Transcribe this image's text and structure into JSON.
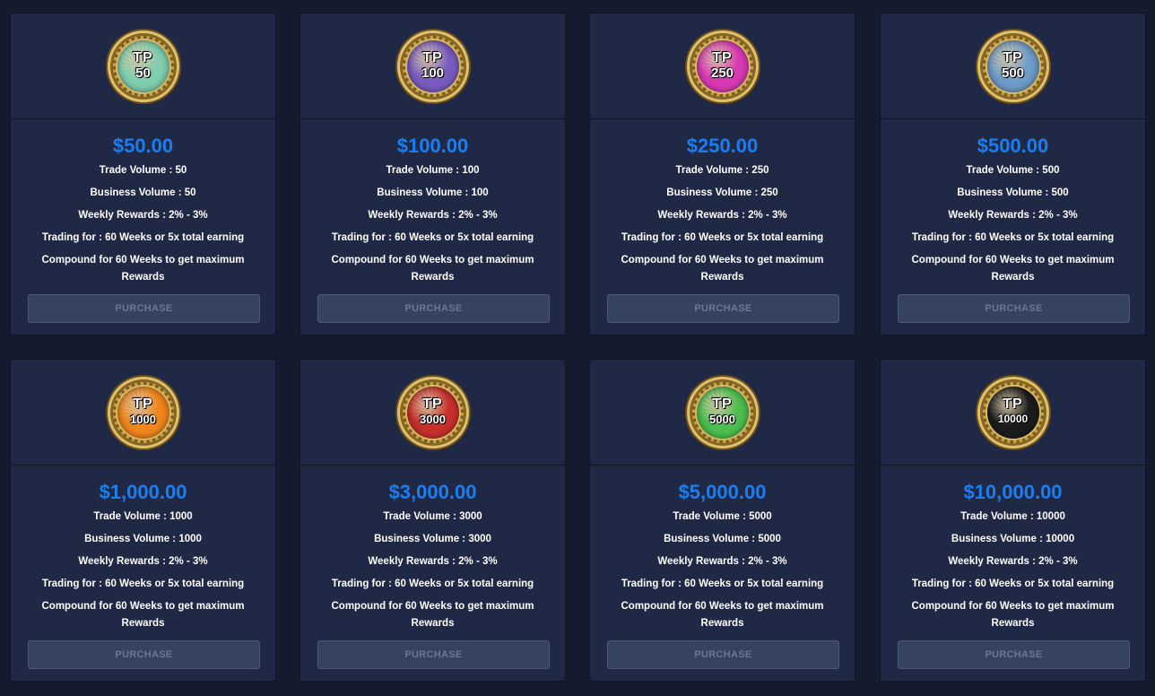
{
  "packages": [
    {
      "tp": "TP",
      "badge_number": "50",
      "badge_color": "#7fcfb0",
      "price": "$50.00",
      "trade_volume": "Trade Volume : 50",
      "business_volume": "Business Volume : 50",
      "weekly_rewards": "Weekly Rewards : 2% - 3%",
      "trading_for": "Trading for : 60 Weeks or 5x total earning",
      "compound": "Compound for 60 Weeks to get maximum Rewards",
      "button": "PURCHASE"
    },
    {
      "tp": "TP",
      "badge_number": "100",
      "badge_color": "#7a5cc0",
      "price": "$100.00",
      "trade_volume": "Trade Volume : 100",
      "business_volume": "Business Volume : 100",
      "weekly_rewards": "Weekly Rewards : 2% - 3%",
      "trading_for": "Trading for : 60 Weeks or 5x total earning",
      "compound": "Compound for 60 Weeks to get maximum Rewards",
      "button": "PURCHASE"
    },
    {
      "tp": "TP",
      "badge_number": "250",
      "badge_color": "#d83ab4",
      "price": "$250.00",
      "trade_volume": "Trade Volume : 250",
      "business_volume": "Business Volume : 250",
      "weekly_rewards": "Weekly Rewards : 2% - 3%",
      "trading_for": "Trading for : 60 Weeks or 5x total earning",
      "compound": "Compound for 60 Weeks to get maximum Rewards",
      "button": "PURCHASE"
    },
    {
      "tp": "TP",
      "badge_number": "500",
      "badge_color": "#6f9cc8",
      "price": "$500.00",
      "trade_volume": "Trade Volume : 500",
      "business_volume": "Business Volume : 500",
      "weekly_rewards": "Weekly Rewards : 2% - 3%",
      "trading_for": "Trading for : 60 Weeks or 5x total earning",
      "compound": "Compound for 60 Weeks to get maximum Rewards",
      "button": "PURCHASE"
    },
    {
      "tp": "TP",
      "badge_number": "1000",
      "badge_color": "#f0861c",
      "price": "$1,000.00",
      "trade_volume": "Trade Volume : 1000",
      "business_volume": "Business Volume : 1000",
      "weekly_rewards": "Weekly Rewards : 2% - 3%",
      "trading_for": "Trading for : 60 Weeks or 5x total earning",
      "compound": "Compound for 60 Weeks to get maximum Rewards",
      "button": "PURCHASE"
    },
    {
      "tp": "TP",
      "badge_number": "3000",
      "badge_color": "#c8302c",
      "price": "$3,000.00",
      "trade_volume": "Trade Volume : 3000",
      "business_volume": "Business Volume : 3000",
      "weekly_rewards": "Weekly Rewards : 2% - 3%",
      "trading_for": "Trading for : 60 Weeks or 5x total earning",
      "compound": "Compound for 60 Weeks to get maximum Rewards",
      "button": "PURCHASE"
    },
    {
      "tp": "TP",
      "badge_number": "5000",
      "badge_color": "#4cbf50",
      "price": "$5,000.00",
      "trade_volume": "Trade Volume : 5000",
      "business_volume": "Business Volume : 5000",
      "weekly_rewards": "Weekly Rewards : 2% - 3%",
      "trading_for": "Trading for : 60 Weeks or 5x total earning",
      "compound": "Compound for 60 Weeks to get maximum Rewards",
      "button": "PURCHASE"
    },
    {
      "tp": "TP",
      "badge_number": "10000",
      "badge_color": "#1c1c1c",
      "price": "$10,000.00",
      "trade_volume": "Trade Volume : 10000",
      "business_volume": "Business Volume : 10000",
      "weekly_rewards": "Weekly Rewards : 2% - 3%",
      "trading_for": "Trading for : 60 Weeks or 5x total earning",
      "compound": "Compound for 60 Weeks to get maximum Rewards",
      "button": "PURCHASE"
    }
  ],
  "colors": {
    "background": "#151b2e",
    "card": "#1f2946",
    "price": "#1a7ef0",
    "button_bg": "#364360",
    "button_text": "#6b7792"
  }
}
